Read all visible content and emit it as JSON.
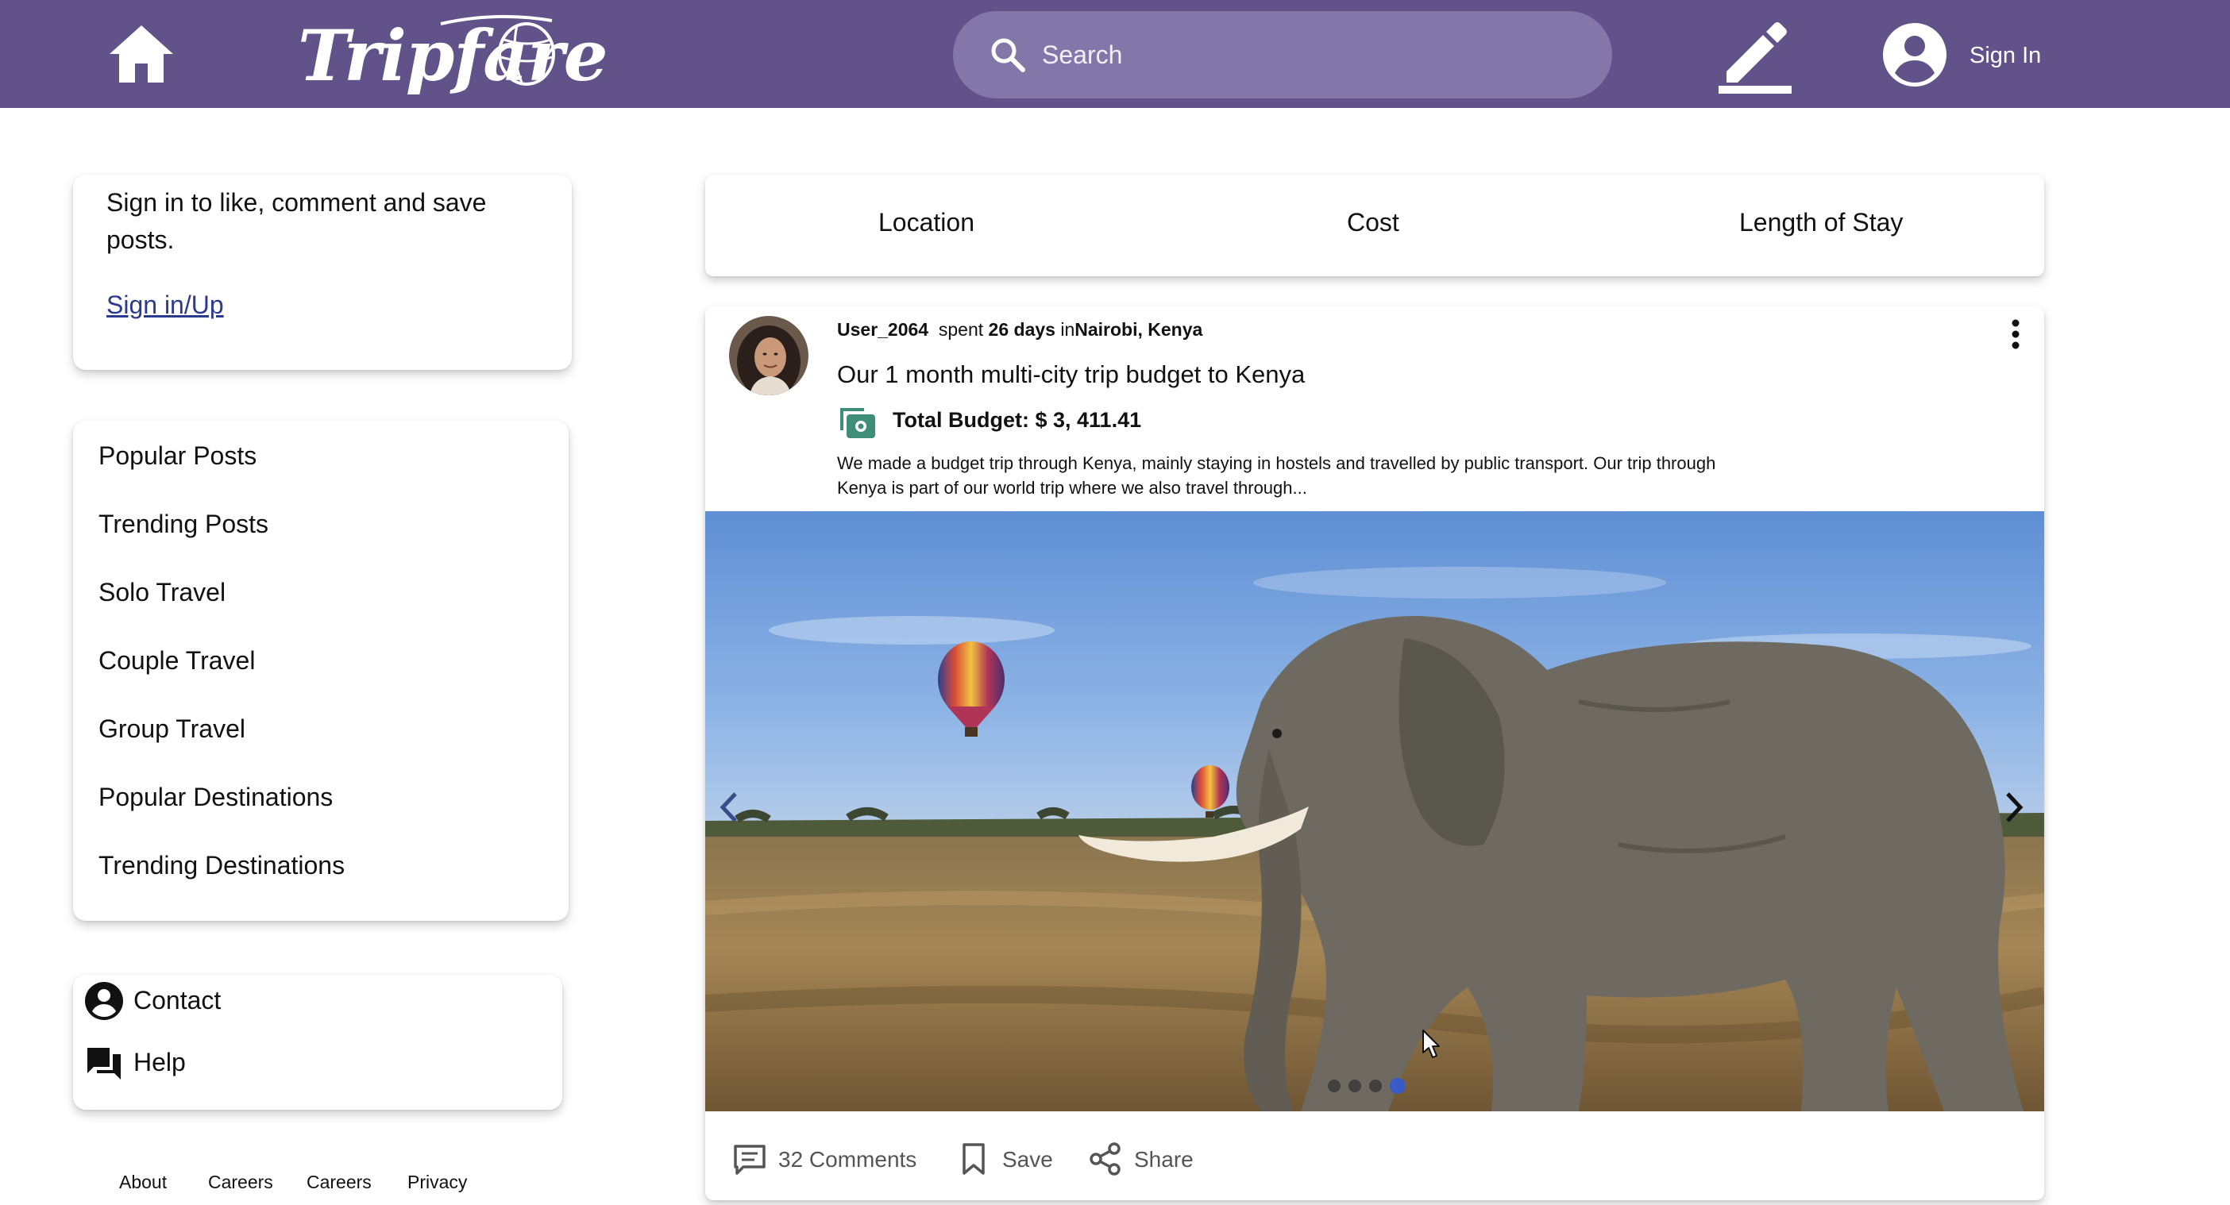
{
  "header": {
    "brand": "Tripfare",
    "search_placeholder": "Search",
    "signin_label": "Sign In",
    "color": "#61528a"
  },
  "sidebar": {
    "signin_prompt": "Sign in to like, comment and save posts.",
    "signin_link": "Sign in/Up",
    "nav_items": [
      "Popular Posts",
      "Trending Posts",
      "Solo Travel",
      "Couple Travel",
      "Group Travel",
      "Popular Destinations",
      "Trending Destinations"
    ],
    "contact_label": "Contact",
    "help_label": "Help"
  },
  "footer": {
    "links": [
      "About",
      "Careers",
      "Careers",
      "Privacy"
    ]
  },
  "filters": {
    "tabs": [
      "Location",
      "Cost",
      "Length of Stay"
    ]
  },
  "post": {
    "username": "User_2064",
    "spent_text": "spent",
    "duration": "26 days",
    "in_text": "in",
    "location": "Nairobi, Kenya",
    "title": "Our 1 month multi-city trip budget to Kenya",
    "budget": "Total Budget: $ 3, 411.41",
    "description": "We made a budget trip through Kenya, mainly staying in hostels and travelled by public transport. Our trip through Kenya is part of our world trip where we also travel through...",
    "carousel": {
      "count": 4,
      "active_index": 3
    },
    "comments_label": "32 Comments",
    "save_label": "Save",
    "share_label": "Share",
    "accent_color": "#3f8f78"
  }
}
